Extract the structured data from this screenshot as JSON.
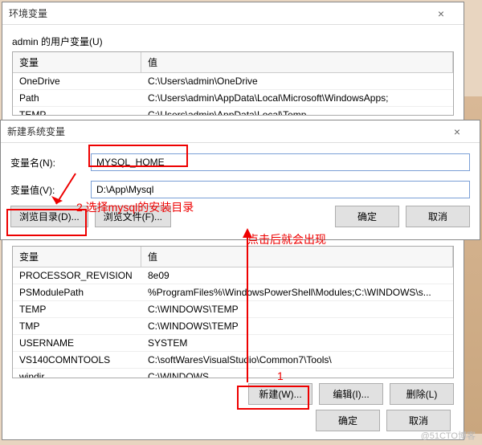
{
  "parent_window": {
    "title": "环境变量",
    "close": "×",
    "user_section_label": "admin 的用户变量(U)",
    "columns": {
      "variable": "变量",
      "value": "值"
    },
    "user_vars": [
      {
        "name": "OneDrive",
        "value": "C:\\Users\\admin\\OneDrive"
      },
      {
        "name": "Path",
        "value": "C:\\Users\\admin\\AppData\\Local\\Microsoft\\WindowsApps;"
      },
      {
        "name": "TEMP",
        "value": "C:\\Users\\admin\\AppData\\Local\\Temp"
      }
    ]
  },
  "new_sys_var_dialog": {
    "title": "新建系统变量",
    "close": "×",
    "name_label": "变量名(N):",
    "name_value": "MYSQL_HOME",
    "value_label": "变量值(V):",
    "value_value": "D:\\App\\Mysql",
    "browse_dir": "浏览目录(D)...",
    "browse_file": "浏览文件(F)...",
    "ok": "确定",
    "cancel": "取消"
  },
  "sys_vars": {
    "columns": {
      "variable": "变量",
      "value": "值"
    },
    "rows": [
      {
        "name": "PROCESSOR_REVISION",
        "value": "8e09"
      },
      {
        "name": "PSModulePath",
        "value": "%ProgramFiles%\\WindowsPowerShell\\Modules;C:\\WINDOWS\\s..."
      },
      {
        "name": "TEMP",
        "value": "C:\\WINDOWS\\TEMP"
      },
      {
        "name": "TMP",
        "value": "C:\\WINDOWS\\TEMP"
      },
      {
        "name": "USERNAME",
        "value": "SYSTEM"
      },
      {
        "name": "VS140COMNTOOLS",
        "value": "C:\\softWaresVisualStudio\\Common7\\Tools\\"
      },
      {
        "name": "windir",
        "value": "C:\\WINDOWS"
      }
    ],
    "new": "新建(W)...",
    "edit": "编辑(I)...",
    "delete": "删除(L)"
  },
  "bottom_buttons": {
    "ok": "确定",
    "cancel": "取消"
  },
  "annotations": {
    "step2": "2 选择mysql的安装目录",
    "after_click": "点击后就会出现",
    "step1": "1"
  },
  "watermark": "@51CTO博客"
}
